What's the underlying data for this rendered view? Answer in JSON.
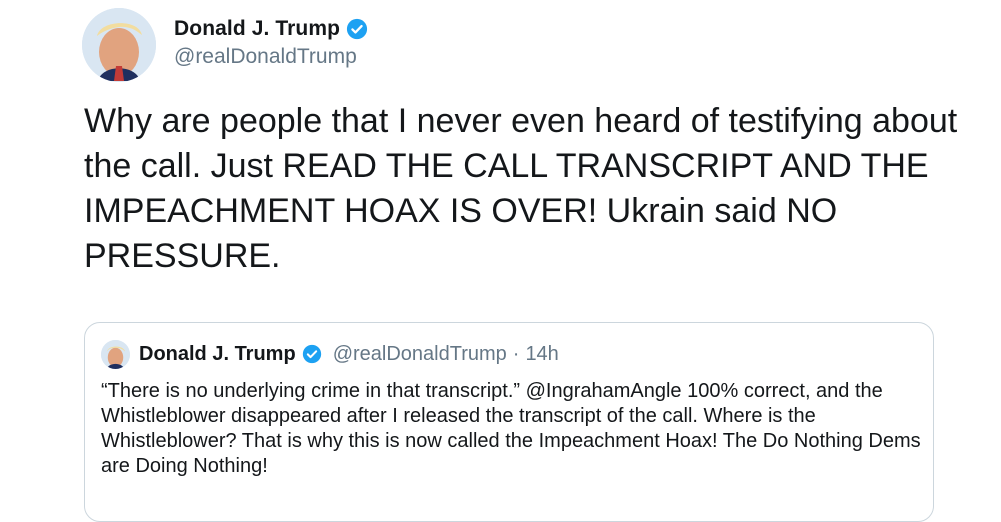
{
  "tweet": {
    "author": {
      "display_name": "Donald J. Trump",
      "handle": "@realDonaldTrump",
      "verified_icon": "verified-badge-icon",
      "avatar_icon": "profile-photo"
    },
    "text": "Why are people that I never even heard of testifying about the call. Just READ THE CALL TRANSCRIPT AND THE IMPEACHMENT HOAX IS OVER! Ukrain said NO PRESSURE."
  },
  "quoted_tweet": {
    "author": {
      "display_name": "Donald J. Trump",
      "handle": "@realDonaldTrump",
      "separator": "·",
      "time": "14h"
    },
    "text": "“There is no underlying crime in that transcript.” @IngrahamAngle  100% correct, and the Whistleblower disappeared after I released the transcript of the call. Where is the Whistleblower? That is why this is now called the Impeachment Hoax! The Do Nothing Dems are Doing Nothing!"
  },
  "colors": {
    "text": "#14171a",
    "secondary": "#657786",
    "verified": "#1da1f2",
    "border": "#ccd6dd"
  }
}
